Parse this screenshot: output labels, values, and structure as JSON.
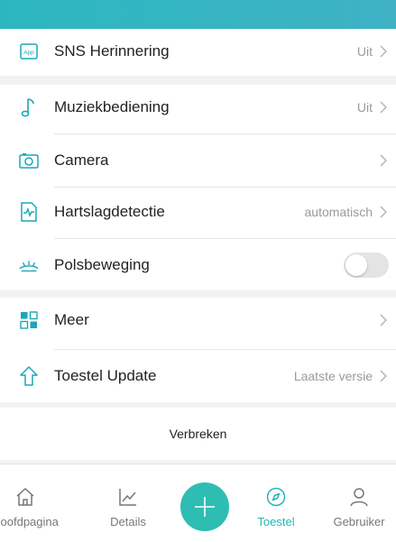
{
  "settings": {
    "sns": {
      "label": "SNS Herinnering",
      "value": "Uit",
      "icon": "app-icon"
    },
    "music": {
      "label": "Muziekbediening",
      "value": "Uit",
      "icon": "music-note-icon"
    },
    "camera": {
      "label": "Camera",
      "icon": "camera-icon"
    },
    "heart": {
      "label": "Hartslagdetectie",
      "value": "automatisch",
      "icon": "heart-rate-icon"
    },
    "wrist": {
      "label": "Polsbeweging",
      "toggle_on": false,
      "icon": "wrist-motion-icon"
    },
    "more": {
      "label": "Meer",
      "icon": "grid-icon"
    },
    "update": {
      "label": "Toestel Update",
      "value": "Laatste versie",
      "icon": "upload-arrow-icon"
    },
    "disconnect": {
      "label": "Verbreken"
    }
  },
  "tabbar": {
    "home": "Hoofdpagina",
    "details": "Details",
    "device": "Toestel",
    "user": "Gebruiker",
    "active": "device"
  },
  "colors": {
    "accent": "#2ebdb2",
    "header": "#2cb7c0",
    "icon": "#1aa7b6"
  }
}
